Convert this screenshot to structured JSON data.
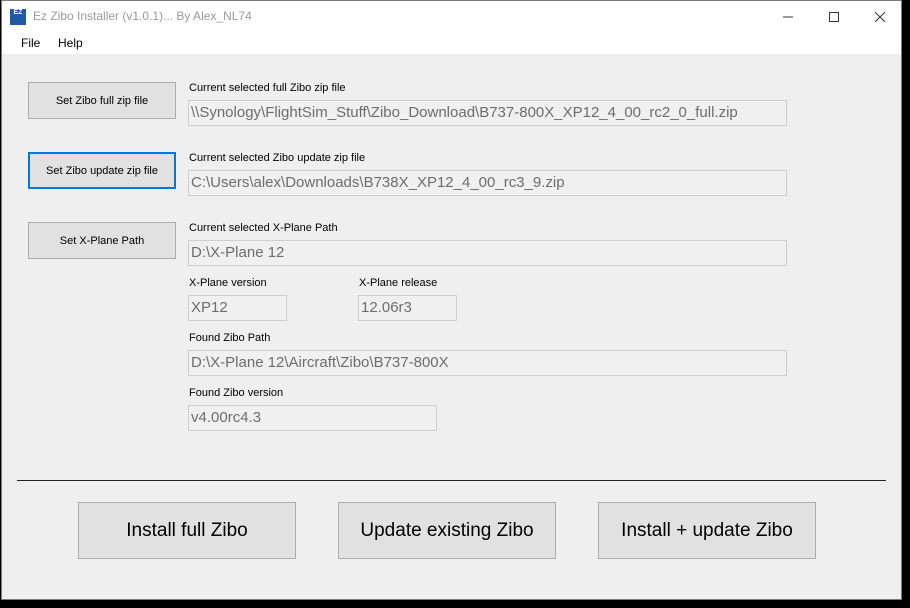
{
  "window": {
    "title": "Ez Zibo Installer (v1.0.1)... By Alex_NL74",
    "icon_text": "EZ"
  },
  "menu": {
    "items": [
      {
        "label": "File"
      },
      {
        "label": "Help"
      }
    ]
  },
  "full_zip": {
    "button_label": "Set Zibo full zip file",
    "caption": "Current selected full Zibo zip file",
    "value": "\\\\Synology\\FlightSim_Stuff\\Zibo_Download\\B737-800X_XP12_4_00_rc2_0_full.zip"
  },
  "update_zip": {
    "button_label": "Set Zibo update zip file",
    "caption": "Current selected Zibo update zip file",
    "value": "C:\\Users\\alex\\Downloads\\B738X_XP12_4_00_rc3_9.zip"
  },
  "xplane_path": {
    "button_label": "Set X-Plane Path",
    "caption": "Current selected X-Plane Path",
    "value": "D:\\X-Plane 12"
  },
  "xplane_version": {
    "caption": "X-Plane version",
    "value": "XP12"
  },
  "xplane_release": {
    "caption": "X-Plane release",
    "value": "12.06r3"
  },
  "zibo_path": {
    "caption": "Found Zibo Path",
    "value": "D:\\X-Plane 12\\Aircraft\\Zibo\\B737-800X"
  },
  "zibo_version": {
    "caption": "Found Zibo version",
    "value": "v4.00rc4.3"
  },
  "actions": {
    "install_full": "Install full Zibo",
    "update_existing": "Update existing Zibo",
    "install_update": "Install + update Zibo"
  },
  "colors": {
    "focus_border": "#0078d7",
    "button_face": "#e1e1e1",
    "client_bg": "#efefef"
  }
}
